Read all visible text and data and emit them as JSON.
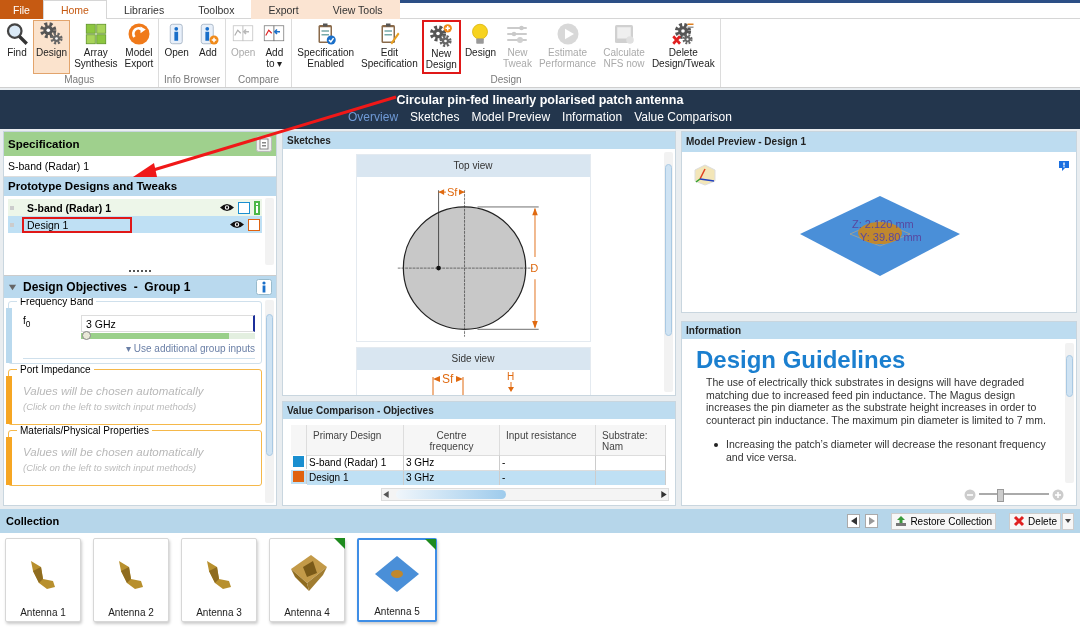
{
  "ribbon_tabs": [
    {
      "label": "File",
      "kind": "file",
      "selected": false
    },
    {
      "label": "Home",
      "kind": "normal",
      "selected": true
    },
    {
      "label": "Libraries",
      "kind": "normal",
      "selected": false
    },
    {
      "label": "Toolbox",
      "kind": "normal",
      "selected": false
    },
    {
      "label": "Export",
      "kind": "contextual",
      "selected": false
    },
    {
      "label": "View Tools",
      "kind": "contextual",
      "selected": false
    }
  ],
  "ribbon_groups": [
    {
      "label": "Magus",
      "buttons": [
        {
          "label": "Find",
          "selected": false,
          "disabled": false,
          "highlighted": false
        },
        {
          "label": "Design",
          "selected": true,
          "disabled": false,
          "highlighted": false
        },
        {
          "label": "Array\nSynthesis",
          "selected": false,
          "disabled": false,
          "highlighted": false
        },
        {
          "label": "Model\nExport",
          "selected": false,
          "disabled": false,
          "highlighted": false
        }
      ]
    },
    {
      "label": "Info Browser",
      "buttons": [
        {
          "label": "Open",
          "selected": false,
          "disabled": false,
          "highlighted": false
        },
        {
          "label": "Add",
          "selected": false,
          "disabled": false,
          "highlighted": false
        }
      ]
    },
    {
      "label": "Compare",
      "buttons": [
        {
          "label": "Open",
          "selected": false,
          "disabled": true,
          "highlighted": false
        },
        {
          "label": "Add\nto ▾",
          "selected": false,
          "disabled": false,
          "highlighted": false
        }
      ]
    },
    {
      "label": "Design",
      "buttons": [
        {
          "label": "Specification\nEnabled",
          "selected": false,
          "disabled": false,
          "highlighted": false
        },
        {
          "label": "Edit\nSpecification",
          "selected": false,
          "disabled": false,
          "highlighted": false
        },
        {
          "label": "New\nDesign",
          "selected": false,
          "disabled": false,
          "highlighted": true
        },
        {
          "label": "Design",
          "selected": false,
          "disabled": false,
          "highlighted": false
        },
        {
          "label": "New\nTweak",
          "selected": false,
          "disabled": true,
          "highlighted": false
        },
        {
          "label": "Estimate\nPerformance",
          "selected": false,
          "disabled": true,
          "highlighted": false
        },
        {
          "label": "Calculate\nNFS now",
          "selected": false,
          "disabled": true,
          "highlighted": false
        },
        {
          "label": "Delete\nDesign/Tweak",
          "selected": false,
          "disabled": false,
          "highlighted": false
        }
      ]
    }
  ],
  "document": {
    "title": "Circular pin-fed linearly polarised patch antenna",
    "nav": [
      {
        "label": "Overview",
        "selected": true
      },
      {
        "label": "Sketches",
        "selected": false
      },
      {
        "label": "Model Preview",
        "selected": false
      },
      {
        "label": "Information",
        "selected": false
      },
      {
        "label": "Value Comparison",
        "selected": false
      }
    ]
  },
  "specification": {
    "title": "Specification",
    "value": "S-band (Radar) 1"
  },
  "prototypes": {
    "title": "Prototype Designs and Tweaks",
    "items": [
      {
        "label": "S-band (Radar) 1",
        "kind": "specification",
        "color": "#1a8fd0",
        "selected": false,
        "highlighted": false
      },
      {
        "label": "Design 1",
        "kind": "design",
        "color": "#e0620f",
        "selected": true,
        "highlighted": true
      }
    ]
  },
  "objectives": {
    "title": "Design Objectives  -  Group 1",
    "expanded": true,
    "groups": [
      {
        "kind": "input",
        "title": "Frequency Band",
        "label": "f$_{0}$",
        "value": "3 GHz",
        "level": 0.03,
        "link": "▾ Use additional group inputs"
      },
      {
        "kind": "automatic",
        "title": "Port Impedance",
        "text": "Values will be chosen automatically",
        "hint": "(Click on the left to switch input methods)"
      },
      {
        "kind": "automatic",
        "title": "Materials/Physical Properties",
        "text": "Values will be chosen automatically",
        "hint": "(Click on the left to switch input methods)"
      }
    ]
  },
  "sketches": {
    "title": "Sketches",
    "top_view": {
      "title": "Top view",
      "feed_label": "Sf",
      "diameter_label": "D"
    },
    "side_view": {
      "title": "Side view",
      "feed_label": "Sf",
      "height_label": "H"
    }
  },
  "value_comparison": {
    "title": "Value Comparison - Objectives",
    "columns": [
      "Primary Design",
      "Centre\nfrequency",
      "Input resistance",
      "Substrate: Nam"
    ],
    "rows": [
      {
        "color": "#1a8fd0",
        "selected": false,
        "cells": [
          "S-band (Radar) 1",
          "3 GHz",
          "-"
        ]
      },
      {
        "color": "#e0620f",
        "selected": true,
        "cells": [
          "Design 1",
          "3 GHz",
          "-"
        ]
      }
    ]
  },
  "model_preview": {
    "title": "Model Preview  -  Design 1",
    "labels": [
      "Z: 2.120 mm",
      "Y: 39.80 mm"
    ]
  },
  "information": {
    "title": "Information",
    "heading": "Design Guidelines",
    "paragraph": "The use of electrically thick substrates in designs will have degraded matching due to increased feed pin inductance. The Magus design increases the pin diameter as the substrate height increases in order to counteract pin inductance. The maximum pin diameter is limited to 7 mm.",
    "bullets": [
      "Increasing the patch’s diameter will decrease the resonant frequency and vice versa."
    ],
    "zoom": {
      "level": 0.3
    }
  },
  "collection": {
    "title": "Collection",
    "buttons": [
      "Restore Collection",
      "Delete"
    ],
    "items": [
      {
        "label": "Antenna 1",
        "kind": "bent",
        "selected": false,
        "flagged": false
      },
      {
        "label": "Antenna 2",
        "kind": "bent",
        "selected": false,
        "flagged": false
      },
      {
        "label": "Antenna 3",
        "kind": "bent",
        "selected": false,
        "flagged": false
      },
      {
        "label": "Antenna 4",
        "kind": "horn",
        "selected": false,
        "flagged": true
      },
      {
        "label": "Antenna 5",
        "kind": "patch",
        "selected": true,
        "flagged": true
      }
    ]
  }
}
